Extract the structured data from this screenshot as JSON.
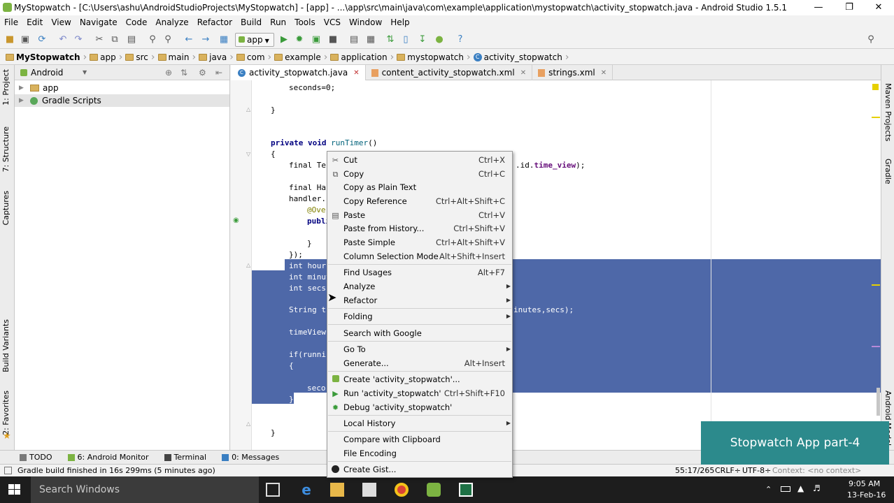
{
  "window": {
    "title": "MyStopwatch - [C:\\Users\\ashu\\AndroidStudioProjects\\MyStopwatch] - [app] - ...\\app\\src\\main\\java\\com\\example\\application\\mystopwatch\\activity_stopwatch.java - Android Studio 1.5.1",
    "minimize": "—",
    "restore": "❐",
    "close": "✕"
  },
  "menu": [
    "File",
    "Edit",
    "View",
    "Navigate",
    "Code",
    "Analyze",
    "Refactor",
    "Build",
    "Run",
    "Tools",
    "VCS",
    "Window",
    "Help"
  ],
  "toolbar": {
    "config": "app"
  },
  "breadcrumbs": [
    "MyStopwatch",
    "app",
    "src",
    "main",
    "java",
    "com",
    "example",
    "application",
    "mystopwatch",
    "activity_stopwatch"
  ],
  "left_tabs": [
    "1: Project",
    "7: Structure",
    "Captures",
    "Build Variants",
    "2: Favorites"
  ],
  "right_tabs": [
    "Maven Projects",
    "Gradle",
    "Android Model"
  ],
  "project": {
    "view": "Android",
    "items": [
      "app",
      "Gradle Scripts"
    ]
  },
  "editor_tabs": [
    {
      "label": "activity_stopwatch.java",
      "active": true
    },
    {
      "label": "content_activity_stopwatch.xml",
      "active": false
    },
    {
      "label": "strings.xml",
      "active": false
    }
  ],
  "code": {
    "l1": "seconds=0;",
    "l2": "}",
    "l3a": "private void ",
    "l3b": "runTimer",
    "l3c": "()",
    "l4": "{",
    "l5a": "final Te",
    "l5b": ".id.",
    "l5c": "time_view",
    "l5d": ");",
    "l6": "final Han",
    "l7": "handler.p",
    "l8": "@Over",
    "l9": "publi",
    "l10": "}",
    "l11": "});",
    "l12": "int hour",
    "l13": "int minut",
    "l14": "int secs",
    "l15a": "String t",
    "l15b": "inutes,secs);",
    "l16": "timeView",
    "l17": "if(runni",
    "l18": "{",
    "l19": "seco",
    "l20": "}",
    "l21": "}"
  },
  "context_menu": {
    "items": [
      {
        "label": "Cut",
        "shortcut": "Ctrl+X",
        "icon": "scissors-icon"
      },
      {
        "label": "Copy",
        "shortcut": "Ctrl+C",
        "icon": "copy-icon"
      },
      {
        "label": "Copy as Plain Text",
        "shortcut": ""
      },
      {
        "label": "Copy Reference",
        "shortcut": "Ctrl+Alt+Shift+C"
      },
      {
        "label": "Paste",
        "shortcut": "Ctrl+V",
        "icon": "paste-icon"
      },
      {
        "label": "Paste from History...",
        "shortcut": "Ctrl+Shift+V"
      },
      {
        "label": "Paste Simple",
        "shortcut": "Ctrl+Alt+Shift+V"
      },
      {
        "label": "Column Selection Mode",
        "shortcut": "Alt+Shift+Insert"
      },
      {
        "label": "Find Usages",
        "shortcut": "Alt+F7"
      },
      {
        "label": "Analyze",
        "shortcut": "",
        "submenu": true
      },
      {
        "label": "Refactor",
        "shortcut": "",
        "submenu": true
      },
      {
        "label": "Folding",
        "shortcut": "",
        "submenu": true
      },
      {
        "label": "Search with Google",
        "shortcut": ""
      },
      {
        "label": "Go To",
        "shortcut": "",
        "submenu": true
      },
      {
        "label": "Generate...",
        "shortcut": "Alt+Insert"
      },
      {
        "label": "Create 'activity_stopwatch'...",
        "shortcut": "",
        "icon": "android-icon"
      },
      {
        "label": "Run 'activity_stopwatch'",
        "shortcut": "Ctrl+Shift+F10",
        "icon": "run-icon"
      },
      {
        "label": "Debug 'activity_stopwatch'",
        "shortcut": "",
        "icon": "debug-icon"
      },
      {
        "label": "Local History",
        "shortcut": "",
        "submenu": true
      },
      {
        "label": "Compare with Clipboard",
        "shortcut": ""
      },
      {
        "label": "File Encoding",
        "shortcut": ""
      },
      {
        "label": "Create Gist...",
        "shortcut": "",
        "icon": "github-icon"
      }
    ]
  },
  "bottom_tabs": [
    "TODO",
    "6: Android Monitor",
    "Terminal",
    "0: Messages"
  ],
  "status": {
    "message": "Gradle build finished in 16s 299ms (5 minutes ago)",
    "position": "55:17/265",
    "line_sep": "CRLF÷",
    "encoding": "UTF-8÷",
    "context": "Context: <no context>"
  },
  "overlay": {
    "text": "Stopwatch App part-4"
  },
  "taskbar": {
    "search_placeholder": "Search Windows",
    "time": "9:05 AM",
    "date": "13-Feb-16"
  },
  "colors": {
    "selection": "#4e68a8",
    "overlay": "#2c8a8c",
    "taskbar": "#1d1d1d"
  }
}
